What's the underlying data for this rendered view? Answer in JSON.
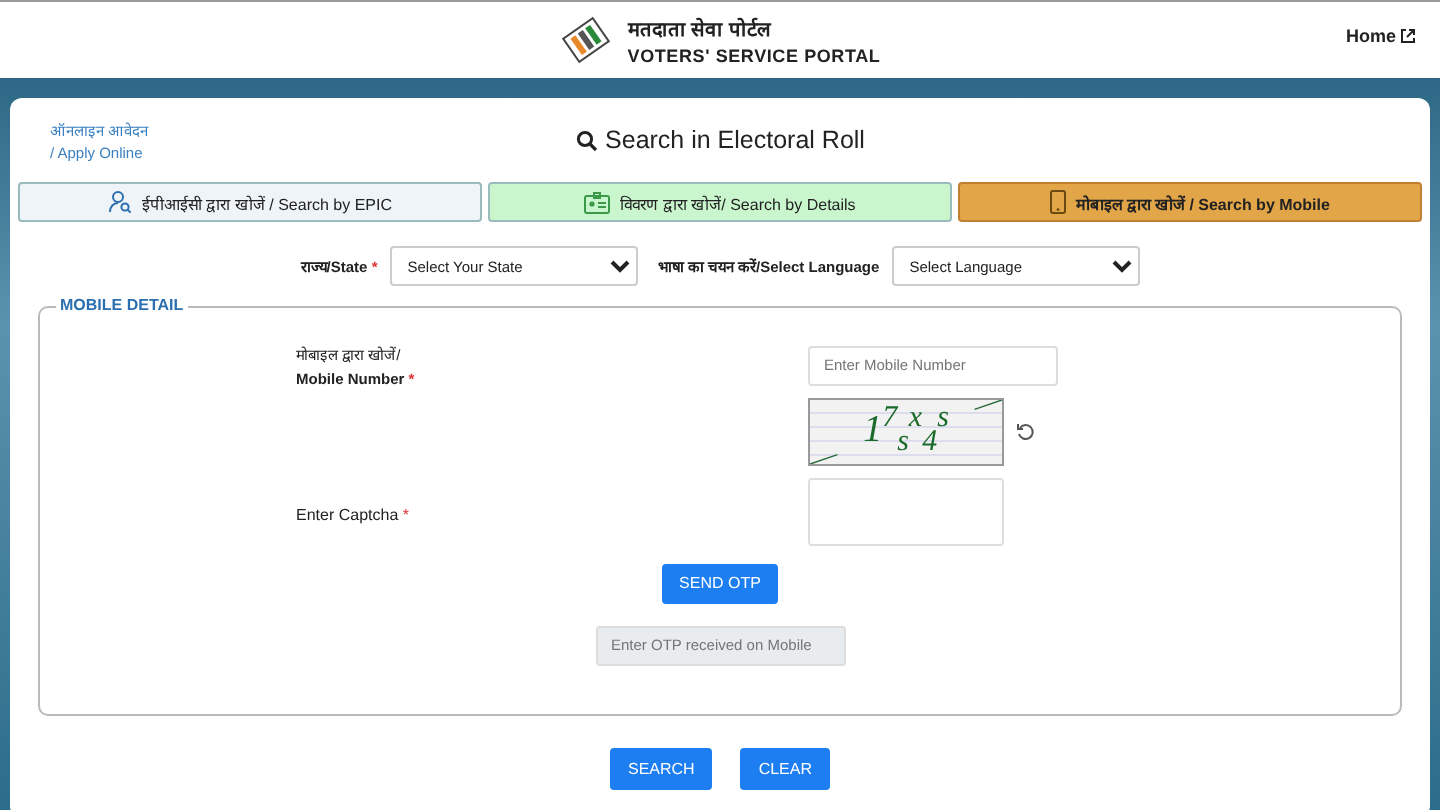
{
  "header": {
    "title_hindi": "मतदाता सेवा पोर्टल",
    "title": "VOTERS' SERVICE PORTAL",
    "home_link": "Home"
  },
  "apply_link": {
    "hindi": "ऑनलाइन आवेदन",
    "english": "/ Apply Online"
  },
  "page_title": "Search in Electoral Roll",
  "tabs": [
    {
      "label": "ईपीआईसी द्वारा खोजें / Search by EPIC",
      "kind": "epic",
      "color": "#eef4f7",
      "selected": false
    },
    {
      "label": "विवरण द्वारा खोजें/ Search by Details",
      "kind": "details",
      "color": "#c9f6cc",
      "selected": false
    },
    {
      "label": "मोबाइल द्वारा खोजें / Search by Mobile",
      "kind": "mobile",
      "color": "#e2a548",
      "selected": true
    }
  ],
  "state_label": "राज्य/State",
  "state_required": "*",
  "mobile_required": "*",
  "captcha_required": "*",
  "state_select": "Select Your State",
  "language_label": "भाषा का चयन करें/Select Language",
  "language_select": "Select Language",
  "fieldset_title": "MOBILE DETAIL",
  "mobile_label_hindi": "मोबाइल द्वारा खोजें/",
  "mobile_label": "Mobile Number",
  "mobile_placeholder": "Enter Mobile Number",
  "captcha_text": "1$^{7}$$_{s}$$^{x}$$_{4}$$^{s}$",
  "captcha_label": "Enter Captcha",
  "send_otp": "SEND OTP",
  "otp_placeholder": "Enter OTP received on Mobile",
  "buttons": [
    "SEARCH",
    "CLEAR"
  ]
}
